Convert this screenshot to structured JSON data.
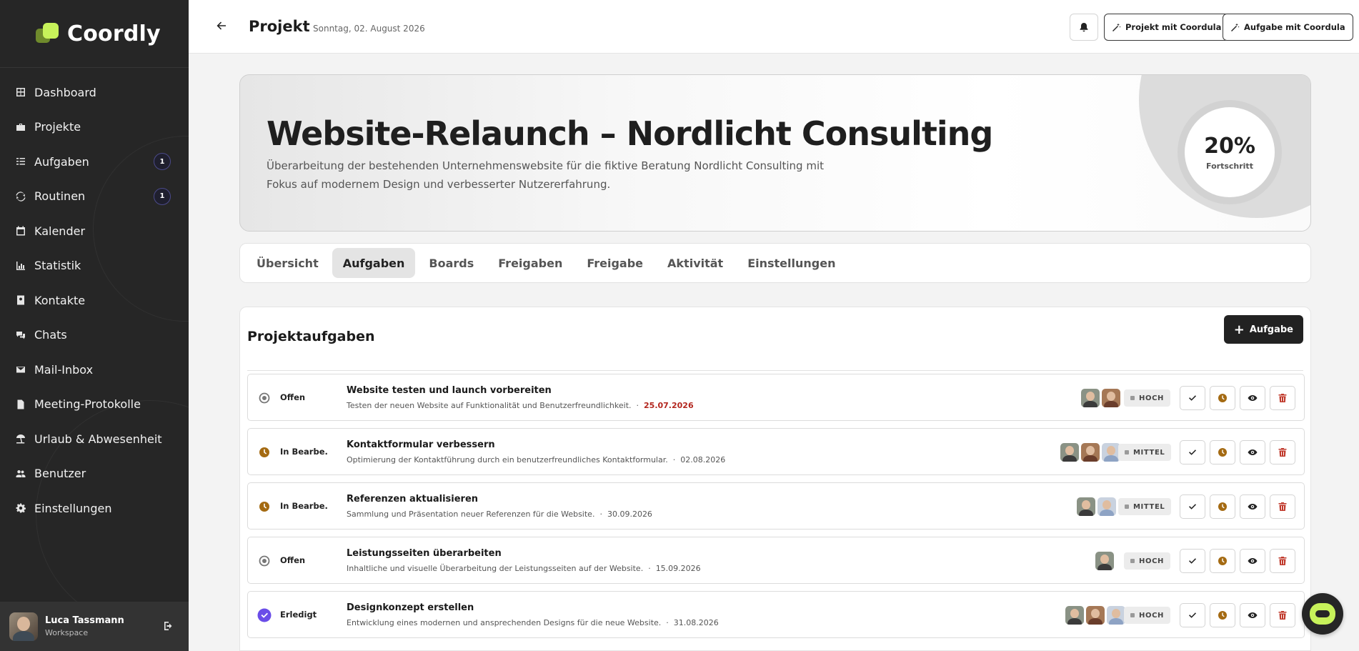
{
  "app": {
    "name": "Coordly"
  },
  "sidebar": {
    "items": [
      {
        "label": "Dashboard",
        "icon": "grid-icon"
      },
      {
        "label": "Projekte",
        "icon": "briefcase-icon"
      },
      {
        "label": "Aufgaben",
        "icon": "list-check-icon",
        "badge": "1"
      },
      {
        "label": "Routinen",
        "icon": "sync-icon",
        "badge": "1"
      },
      {
        "label": "Kalender",
        "icon": "calendar-icon"
      },
      {
        "label": "Statistik",
        "icon": "chart-icon"
      },
      {
        "label": "Kontakte",
        "icon": "address-book-icon"
      },
      {
        "label": "Chats",
        "icon": "chat-bubbles-icon"
      },
      {
        "label": "Mail-Inbox",
        "icon": "envelope-icon"
      },
      {
        "label": "Meeting-Protokolle",
        "icon": "document-icon"
      },
      {
        "label": "Urlaub & Abwesenheit",
        "icon": "beach-umbrella-icon"
      },
      {
        "label": "Benutzer",
        "icon": "users-icon"
      },
      {
        "label": "Einstellungen",
        "icon": "gear-icon"
      }
    ],
    "user": {
      "name": "Luca Tassmann",
      "subtitle": "Workspace"
    }
  },
  "header": {
    "title": "Projekt",
    "date": "Sonntag, 02. August 2026",
    "btn_project": "Projekt mit Coordula",
    "btn_task": "Aufgabe mit Coordula"
  },
  "hero": {
    "title": "Website-Relaunch – Nordlicht Consulting",
    "description": "Überarbeitung der bestehenden Unternehmenswebsite für die fiktive Beratung Nordlicht Consulting mit Fokus auf modernem Design und verbesserter Nutzererfahrung.",
    "progress_value": "20%",
    "progress_label": "Fortschritt"
  },
  "tabs": [
    "Übersicht",
    "Aufgaben",
    "Boards",
    "Freigaben",
    "Freigabe",
    "Aktivität",
    "Einstellungen"
  ],
  "tasks_panel": {
    "title": "Projektaufgaben",
    "add_label": "Aufgabe",
    "tasks": [
      {
        "status": "Offen",
        "title": "Website testen und launch vorbereiten",
        "desc": "Testen der neuen Website auf Funktionalität und Benutzerfreundlichkeit.",
        "sep": "·",
        "due": "25.07.2026",
        "priority": "HOCH"
      },
      {
        "status": "In Bearbe...",
        "title": "Kontaktformular verbessern",
        "desc": "Optimierung der Kontaktführung durch ein benutzerfreundliches Kontaktformular.",
        "sep": "·",
        "due": "02.08.2026",
        "priority": "MITTEL"
      },
      {
        "status": "In Bearbe...",
        "title": "Referenzen aktualisieren",
        "desc": "Sammlung und Präsentation neuer Referenzen für die Website.",
        "sep": "·",
        "due": "30.09.2026",
        "priority": "MITTEL"
      },
      {
        "status": "Offen",
        "title": "Leistungsseiten überarbeiten",
        "desc": "Inhaltliche und visuelle Überarbeitung der Leistungsseiten auf der Website.",
        "sep": "·",
        "due": "15.09.2026",
        "priority": "HOCH"
      },
      {
        "status": "Erledigt",
        "title": "Designkonzept erstellen",
        "desc": "Entwicklung eines modernen und ansprechenden Designs für die neue Website.",
        "sep": "·",
        "due": "31.08.2026",
        "priority": "HOCH"
      }
    ]
  },
  "colors": {
    "sidebar_bg": "#262626",
    "accent_lime": "#c7f25a",
    "overdue_red": "#b3261e",
    "progress_amber": "#a46a12",
    "done_purple": "#6a4de8",
    "delete_red": "#c0392b"
  }
}
